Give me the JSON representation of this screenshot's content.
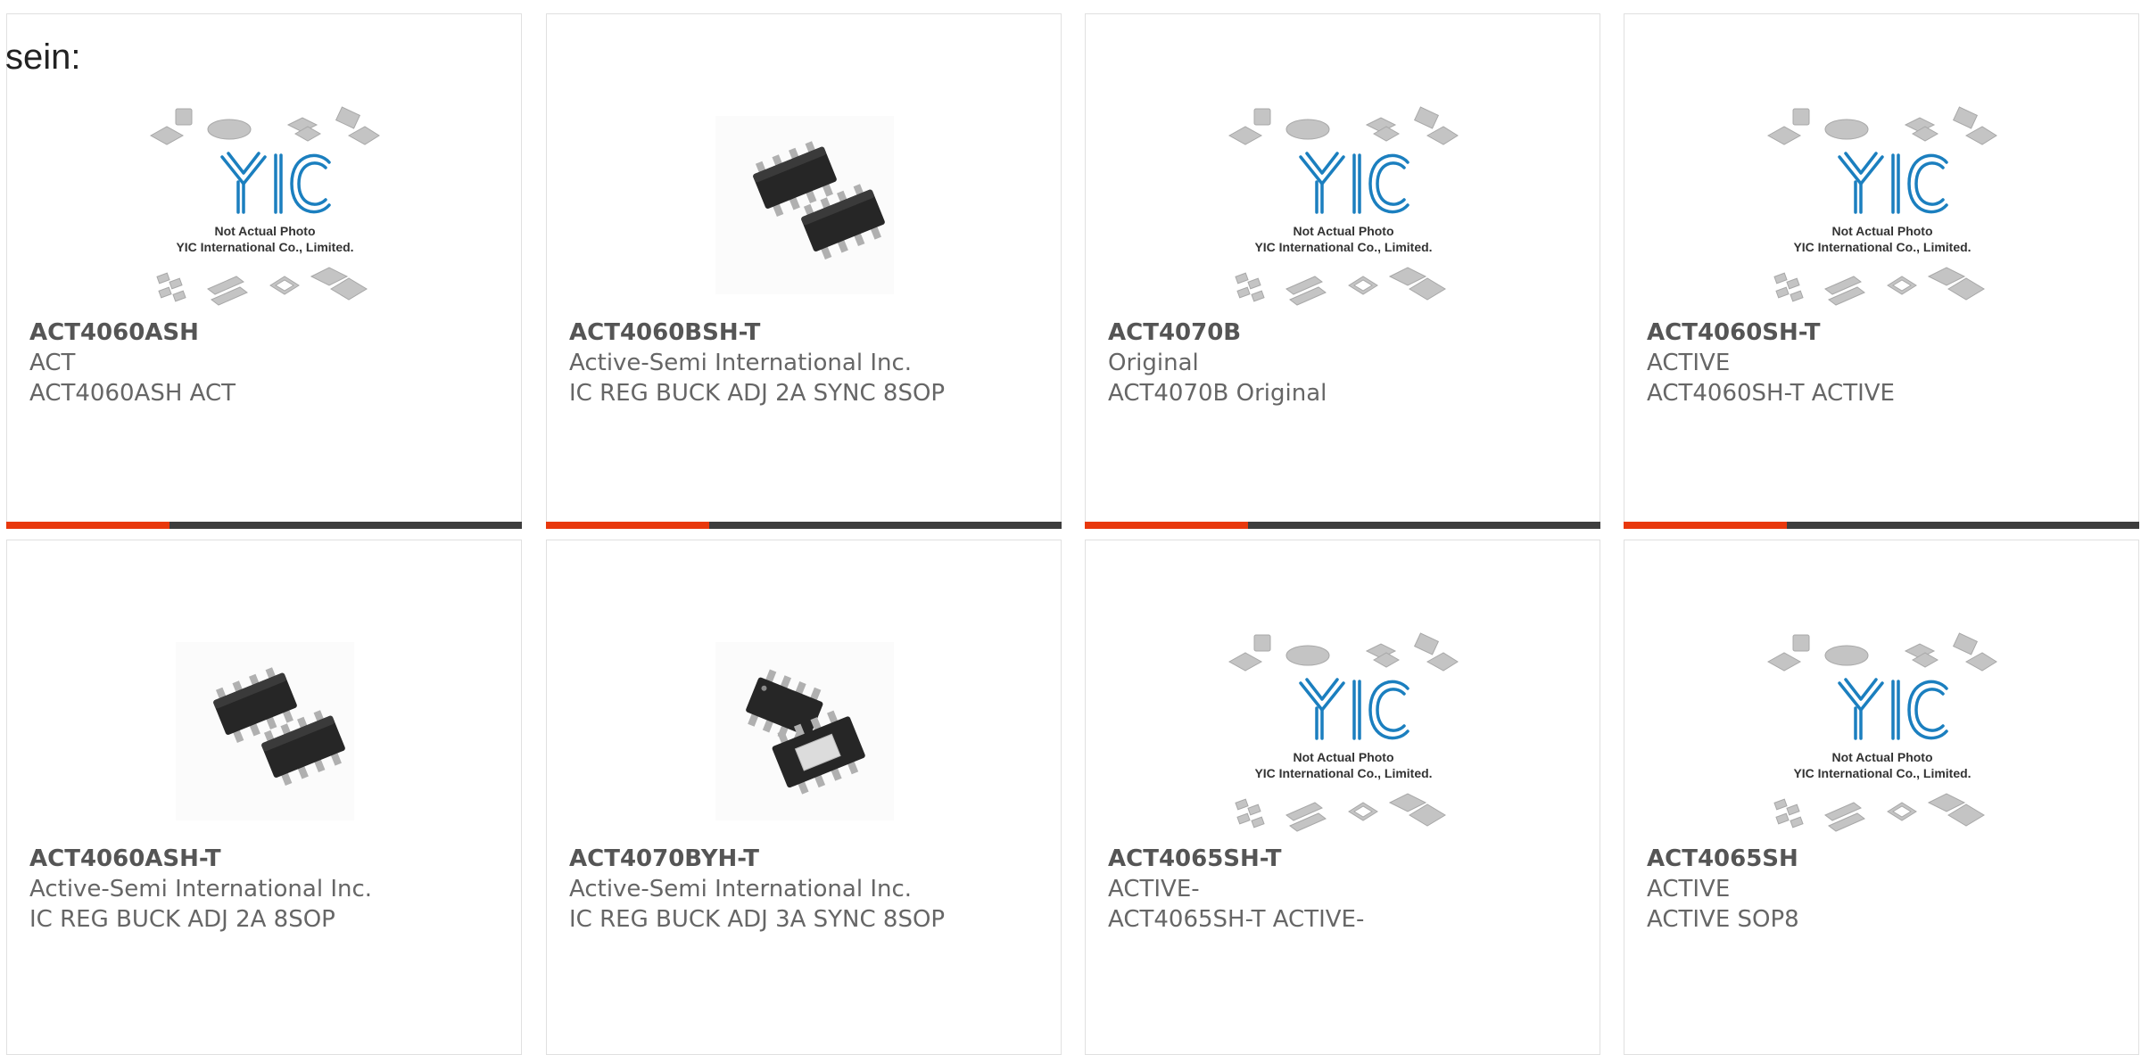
{
  "heading": "sein:",
  "placeholder": {
    "line1": "Not Actual Photo",
    "line2": "YIC International Co., Limited.",
    "logo": "YIC"
  },
  "colors": {
    "accent": "#e8380d",
    "bar": "#3d3d3d",
    "text": "#666666",
    "logo_blue": "#1b7fbf"
  },
  "products": [
    {
      "part": "ACT4060ASH",
      "mfr": "ACT",
      "desc": "ACT4060ASH ACT",
      "image": "placeholder-logo",
      "has_bar": true
    },
    {
      "part": "ACT4060BSH-T",
      "mfr": "Active-Semi International Inc.",
      "desc": "IC REG BUCK ADJ 2A SYNC 8SOP",
      "image": "sop8-chip-pair",
      "has_bar": true
    },
    {
      "part": "ACT4070B",
      "mfr": "Original",
      "desc": "ACT4070B Original",
      "image": "placeholder-logo",
      "has_bar": true
    },
    {
      "part": "ACT4060SH-T",
      "mfr": "ACTIVE",
      "desc": "ACT4060SH-T ACTIVE",
      "image": "placeholder-logo",
      "has_bar": true
    },
    {
      "part": "ACT4060ASH-T",
      "mfr": "Active-Semi International Inc.",
      "desc": "IC REG BUCK ADJ 2A 8SOP",
      "image": "sop8-chip-pair",
      "has_bar": false
    },
    {
      "part": "ACT4070BYH-T",
      "mfr": "Active-Semi International Inc.",
      "desc": "IC REG BUCK ADJ 3A SYNC 8SOP",
      "image": "sop8-thermal-pad",
      "has_bar": false
    },
    {
      "part": "ACT4065SH-T",
      "mfr": "ACTIVE-",
      "desc": "ACT4065SH-T ACTIVE-",
      "image": "placeholder-logo",
      "has_bar": false
    },
    {
      "part": "ACT4065SH",
      "mfr": "ACTIVE",
      "desc": "ACTIVE SOP8",
      "image": "placeholder-logo",
      "has_bar": false
    }
  ]
}
